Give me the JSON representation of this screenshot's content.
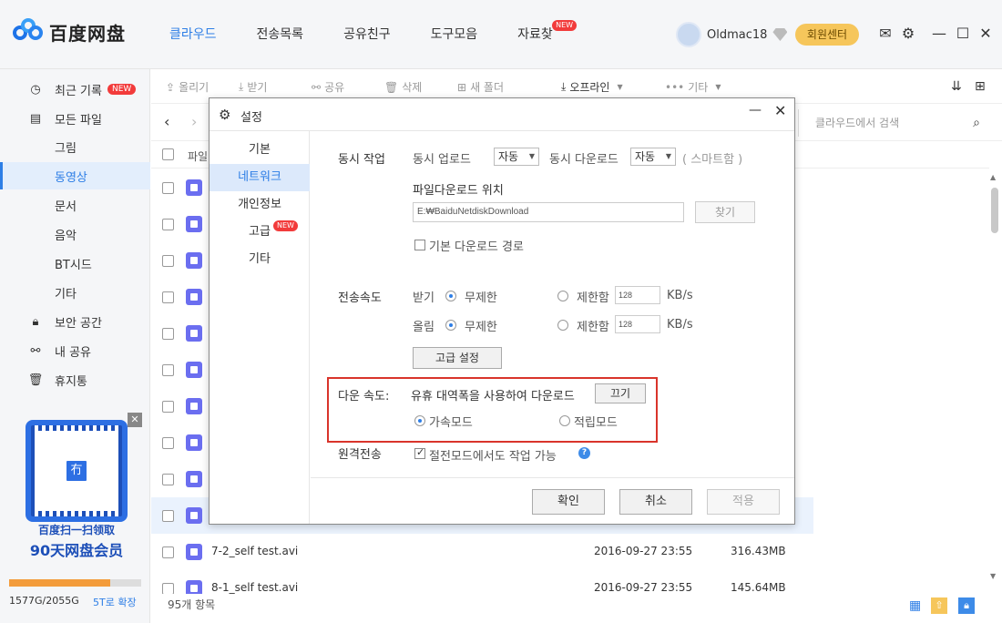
{
  "app": {
    "logo_text": "百度网盘",
    "nav": [
      "클라우드",
      "전송목록",
      "공유친구",
      "도구모음",
      "자료찾"
    ],
    "new_badge": "NEW",
    "username": "Oldmac18",
    "member_center": "회원센터",
    "accent": "#2d7ee6"
  },
  "sidebar": {
    "items": [
      "최근 기록",
      "모든 파일",
      "그림",
      "동영상",
      "문서",
      "음악",
      "BT시드",
      "기타",
      "보안 공간",
      "내 공유",
      "휴지통"
    ],
    "promo_line1": "百度扫一扫领取",
    "promo_line2": "90天网盘会员",
    "storage_text": "1577G/2055G",
    "storage_used_fraction": 0.767,
    "expand_link": "5T로 확장"
  },
  "toolbar": {
    "upload": "올리기",
    "download": "받기",
    "share": "공유",
    "delete": "삭제",
    "new_folder": "새 폴더",
    "offline": "오프라인",
    "more": "기타",
    "search_placeholder": "클라우드에서 검색"
  },
  "filelist": {
    "header_name": "파일",
    "rows": [
      {
        "name": "7-2_self test.avi",
        "date": "2016-09-27 23:55",
        "size": "316.43MB"
      },
      {
        "name": "8-1_self test.avi",
        "date": "2016-09-27 23:55",
        "size": "145.64MB"
      }
    ],
    "status": "95개 항목"
  },
  "dialog": {
    "title": "설정",
    "nav": [
      "기본",
      "네트워크",
      "개인정보",
      "고급",
      "기타"
    ],
    "active_nav": "네트워크",
    "concurrent_label": "동시 작업",
    "concurrent_upload": "동시 업로드",
    "upload_value": "자동",
    "concurrent_download": "동시 다운로드",
    "download_value": "자동",
    "smart_note": "( 스마트함 )",
    "path_label": "파일다운로드 위치",
    "path_value": "E:₩BaiduNetdiskDownload",
    "browse": "찾기",
    "default_path": "기본 다운로드 경로",
    "speed_label": "전송속도",
    "receive": "받기",
    "upload": "올림",
    "unlimited": "무제한",
    "limited": "제한함",
    "limit_value": "128",
    "unit": "KB/s",
    "advanced_btn": "고급 설정",
    "down_speed_label": "다운 속도:",
    "idle_bw": "유휴 대역폭을 사용하여 다운로드",
    "off_btn": "끄기",
    "accel_mode": "가속모드",
    "economy_mode": "적립모드",
    "remote_label": "원격전송",
    "power_save": "절전모드에서도 작업 가능",
    "ok": "확인",
    "cancel": "취소",
    "apply": "적용"
  }
}
